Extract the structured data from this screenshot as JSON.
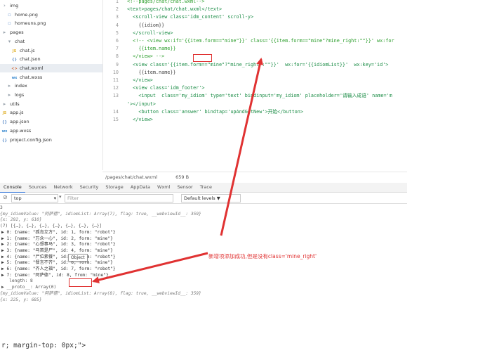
{
  "file_tree": [
    {
      "label": "img",
      "icon": "folder-icon",
      "glyph": "›",
      "indent": 0
    },
    {
      "label": "home.png",
      "icon": "image-file-icon",
      "glyph": "▫",
      "indent": 1
    },
    {
      "label": "homeuns.png",
      "icon": "image-file-icon",
      "glyph": "▫",
      "indent": 1
    },
    {
      "label": "pages",
      "icon": "folder-icon",
      "glyph": "▸",
      "indent": 0
    },
    {
      "label": "chat",
      "icon": "folder-icon",
      "glyph": "▾",
      "indent": 1
    },
    {
      "label": "chat.js",
      "icon": "js-file-icon",
      "glyph": "JS",
      "indent": 2
    },
    {
      "label": "chat.json",
      "icon": "json-file-icon",
      "glyph": "{}",
      "indent": 2
    },
    {
      "label": "chat.wxml",
      "icon": "wxml-file-icon",
      "glyph": "<>",
      "indent": 2
    },
    {
      "label": "chat.wxss",
      "icon": "wxss-file-icon",
      "glyph": "wx",
      "indent": 2
    },
    {
      "label": "index",
      "icon": "folder-icon",
      "glyph": "▸",
      "indent": 1
    },
    {
      "label": "logs",
      "icon": "folder-icon",
      "glyph": "▸",
      "indent": 1
    },
    {
      "label": "utils",
      "icon": "folder-icon",
      "glyph": "▸",
      "indent": 0
    },
    {
      "label": "app.js",
      "icon": "js-file-icon",
      "glyph": "JS",
      "indent": 0
    },
    {
      "label": "app.json",
      "icon": "json-file-icon",
      "glyph": "{}",
      "indent": 0
    },
    {
      "label": "app.wxss",
      "icon": "wxss-file-icon",
      "glyph": "wx",
      "indent": 0
    },
    {
      "label": "project.config.json",
      "icon": "json-file-icon",
      "glyph": "{}",
      "indent": 0
    }
  ],
  "editor": {
    "lines": [
      {
        "num": "1",
        "text": "<!--pages/chat/chat.wxml-->"
      },
      {
        "num": "2",
        "text": "<text>pages/chat/chat.wxml</text>"
      },
      {
        "num": "3",
        "text": "  <scroll-view class='idm_content' scroll-y>"
      },
      {
        "num": "4",
        "text": "    {{idiom}}"
      },
      {
        "num": "5",
        "text": "  </scroll-view>"
      },
      {
        "num": "6",
        "text": "  <!-- <view wx:if='{{item.form==\"mine\"}}' class='{{item.form==\"mine\"?mine_right:\"\"}}' wx:for"
      },
      {
        "num": "7",
        "text": "    {{item.name}}"
      },
      {
        "num": "8",
        "text": "  </view> -->"
      },
      {
        "num": "9",
        "text": "  <view class='{{item.form==\"mine\"?\"mine_right\":\"\"}}'  wx:for='{{idiomList}}'  wx:key='id'>"
      },
      {
        "num": "10",
        "text": "    {{item.name}}"
      },
      {
        "num": "11",
        "text": "  </view>"
      },
      {
        "num": "12",
        "text": "  <view class='idm_footer'>"
      },
      {
        "num": "13",
        "text": "    <input  class='my_idiom' type='text' bindinput='my_idiom' placeholder='请输入成语' name='m"
      },
      {
        "num": "",
        "text": "'></input>"
      },
      {
        "num": "14",
        "text": "    <button class='answer' bindtap='upAndGetNew'>开始</button>"
      },
      {
        "num": "15",
        "text": "  </view>"
      }
    ]
  },
  "status_bar": {
    "path": "/pages/chat/chat.wxml",
    "size": "659 B"
  },
  "devtools": {
    "tabs": [
      "Console",
      "Sources",
      "Network",
      "Security",
      "Storage",
      "AppData",
      "Wxml",
      "Sensor",
      "Trace"
    ],
    "active_tab": "Console",
    "context": "top",
    "filter_placeholder": "Filter",
    "levels": "Default levels ▼"
  },
  "console_lines": [
    "3",
    "{my_idiomValue: \"阿萨德\", idiomList: Array(7), flag: true, __webviewId__: 359}",
    "{x: 292, y: 610}",
    "(7) [{…}, {…}, {…}, {…}, {…}, {…}, {…}]",
    "▶ 0: {name: \"孤岛立方\", id: 1, form: \"robot\"}",
    "▶ 1: {name: \"万众一心\", id: 2, form: \"mine\"}",
    "▶ 2: {name: \"心想事马\", id: 3, form: \"robot\"}",
    "▶ 3: {name: \"马首是尸\", id: 4, form: \"mine\"}",
    "▶ 4: {name: \"尸位素餐\", id: 5, form: \"robot\"}",
    "▶ 5: {name: \"餐言不齐\", id: 6, form: \"mine\"}",
    "▶ 6: {name: \"齐人之福\", id: 7, form: \"robot\"}",
    "▶ 7: {name: \"阿萨德\", id: 8, from: \"mine\"}",
    "   length: 8",
    "▶ __proto__: Array(0)",
    "{my_idiomValue: \"阿萨德\", idiomList: Array(8), flag: true, __webviewId__: 359}",
    "{x: 225, y: 685}"
  ],
  "tooltip": "Object",
  "annotation": "新增项添加成功,但是没有class='mine_right'",
  "bottom_text": "r; margin-top: 0px;\">",
  "colors": {
    "annotation": "#e03232",
    "accent": "#3879d9"
  }
}
